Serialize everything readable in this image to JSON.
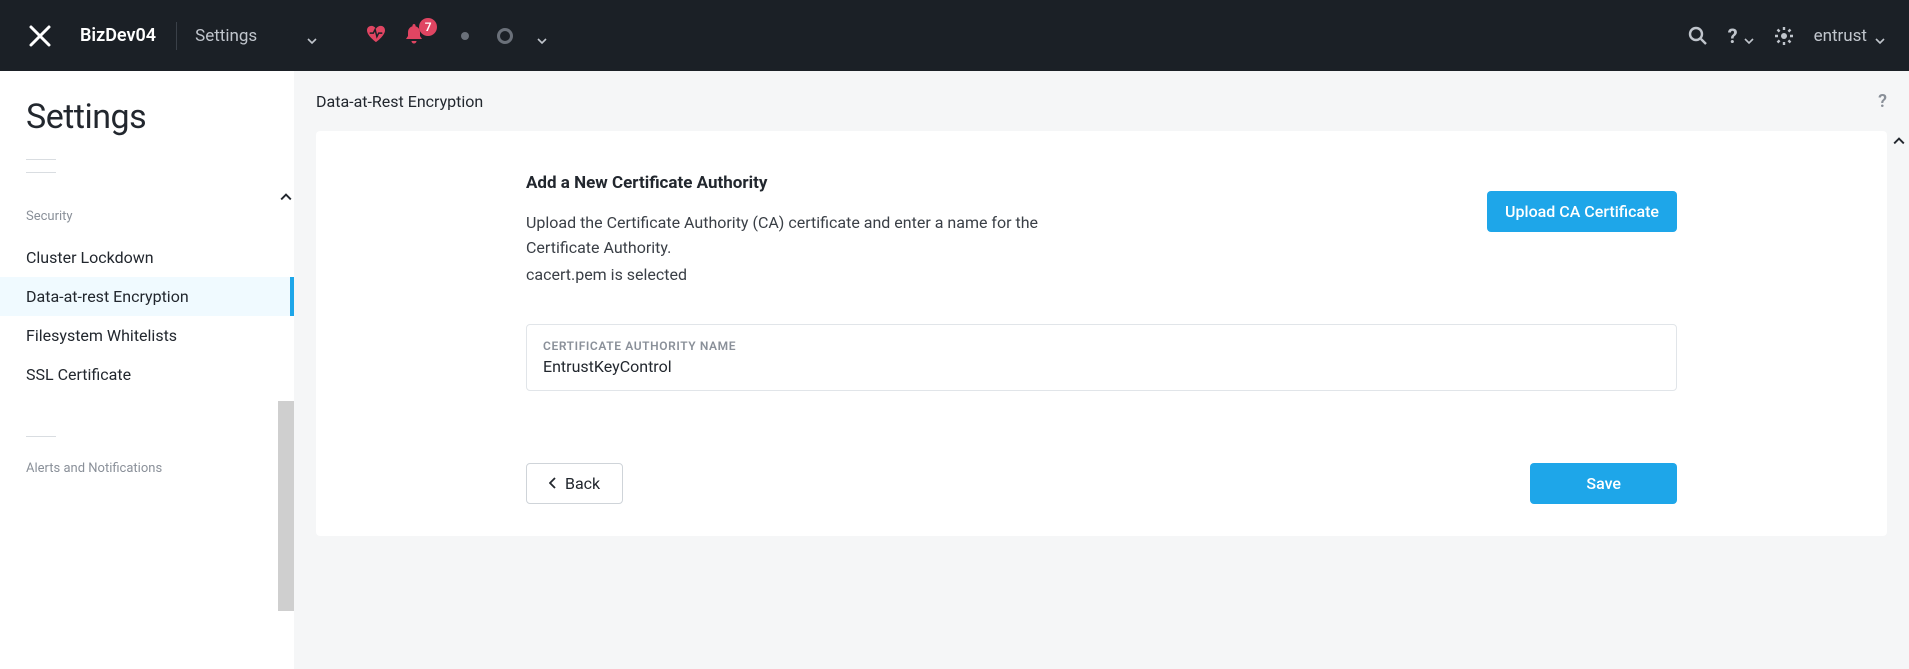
{
  "header": {
    "cluster_name": "BizDev04",
    "section": "Settings",
    "alert_count": "7",
    "user": "entrust"
  },
  "sidebar": {
    "title": "Settings",
    "group_security": "Security",
    "items": [
      {
        "label": "Cluster Lockdown"
      },
      {
        "label": "Data-at-rest Encryption"
      },
      {
        "label": "Filesystem Whitelists"
      },
      {
        "label": "SSL Certificate"
      }
    ],
    "group_alerts": "Alerts and Notifications"
  },
  "content": {
    "page_title": "Data-at-Rest Encryption",
    "panel_title": "Add a New Certificate Authority",
    "description": "Upload the Certificate Authority (CA) certificate and enter a name for the Certificate Authority.",
    "selected_file": "cacert.pem is selected",
    "upload_label": "Upload CA Certificate",
    "field_label": "CERTIFICATE AUTHORITY NAME",
    "field_value": "EntrustKeyControl",
    "back_label": "Back",
    "save_label": "Save",
    "help_glyph": "?"
  }
}
